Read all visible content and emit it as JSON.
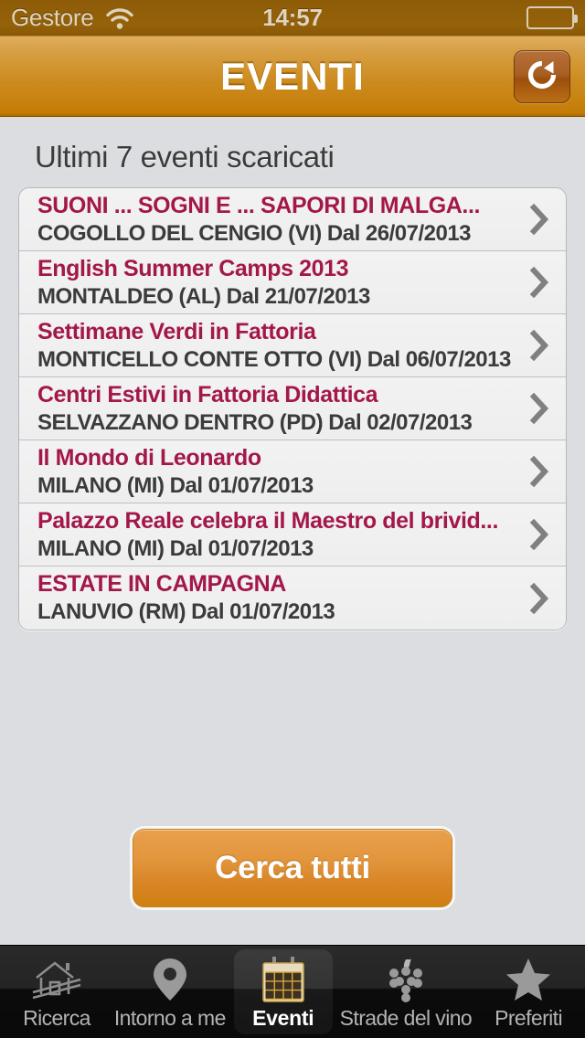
{
  "status_bar": {
    "carrier": "Gestore",
    "wifi_icon": "wifi-icon",
    "time": "14:57",
    "battery_icon": "battery-icon"
  },
  "nav_bar": {
    "title": "EVENTI",
    "refresh_icon": "refresh-icon"
  },
  "main": {
    "heading": "Ultimi 7 eventi scaricati",
    "chevron_icon": "chevron-right-icon",
    "events": [
      {
        "title": "SUONI ... SOGNI E ... SAPORI DI MALGA...",
        "subtitle": "COGOLLO DEL CENGIO (VI)  Dal 26/07/2013"
      },
      {
        "title": "English Summer Camps 2013",
        "subtitle": "MONTALDEO (AL)  Dal 21/07/2013"
      },
      {
        "title": "Settimane Verdi in Fattoria",
        "subtitle": "MONTICELLO CONTE OTTO (VI)  Dal 06/07/2013"
      },
      {
        "title": "Centri Estivi in Fattoria Didattica",
        "subtitle": "SELVAZZANO DENTRO (PD)  Dal 02/07/2013"
      },
      {
        "title": "Il Mondo di Leonardo",
        "subtitle": "MILANO (MI)  Dal 01/07/2013"
      },
      {
        "title": "Palazzo Reale celebra il Maestro del brivid...",
        "subtitle": "MILANO (MI)  Dal 01/07/2013"
      },
      {
        "title": "ESTATE IN CAMPAGNA",
        "subtitle": "LANUVIO (RM)  Dal 01/07/2013"
      }
    ],
    "cta_label": "Cerca tutti"
  },
  "tab_bar": {
    "tabs": [
      {
        "label": "Ricerca",
        "icon": "farmhouse-icon",
        "active": false
      },
      {
        "label": "Intorno a me",
        "icon": "map-pin-icon",
        "active": false
      },
      {
        "label": "Eventi",
        "icon": "calendar-icon",
        "active": true
      },
      {
        "label": "Strade del vino",
        "icon": "grapes-icon",
        "active": false
      },
      {
        "label": "Preferiti",
        "icon": "star-icon",
        "active": false
      }
    ]
  },
  "colors": {
    "accent_crimson": "#a31749",
    "nav_orange": "#cd8c20",
    "status_brown": "#95620a",
    "button_orange": "#e2953c",
    "page_background": "#dcdde0"
  }
}
